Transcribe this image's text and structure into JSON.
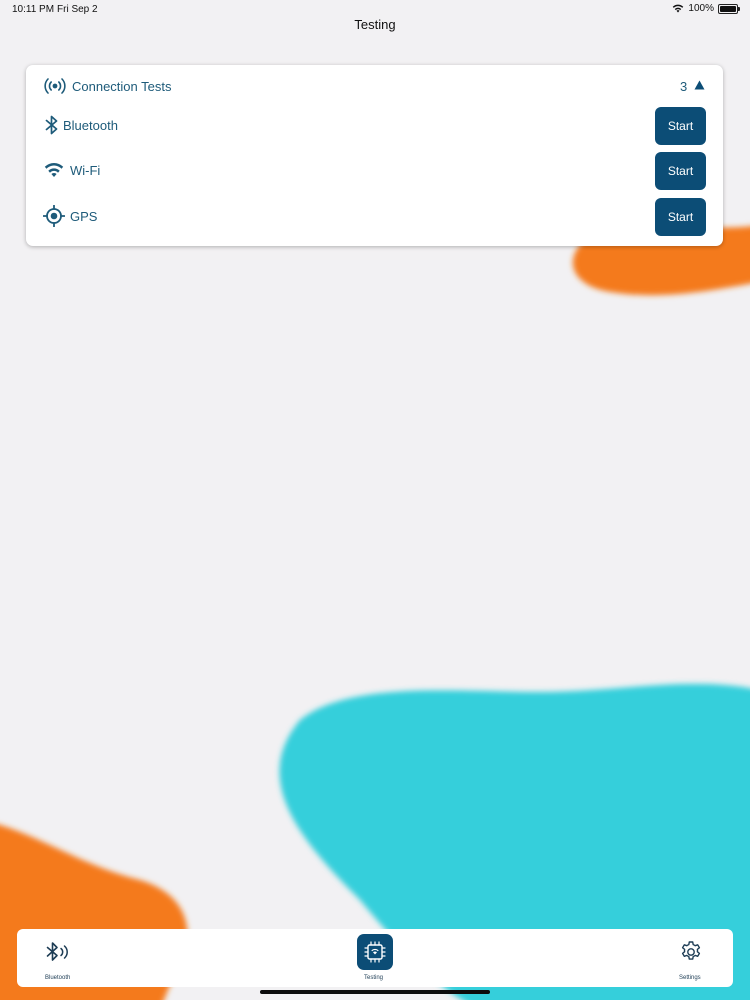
{
  "status_bar": {
    "time": "10:11 PM",
    "date": "Fri Sep 2",
    "battery": "100%"
  },
  "nav": {
    "title": "Testing"
  },
  "card": {
    "title": "Connection Tests",
    "count": "3",
    "header_icon": "broadcast-icon",
    "chevron_icon": "chevron-up-icon",
    "rows": [
      {
        "label": "Bluetooth",
        "icon": "bluetooth-icon",
        "button": "Start"
      },
      {
        "label": "Wi-Fi",
        "icon": "wifi-icon",
        "button": "Start"
      },
      {
        "label": "GPS",
        "icon": "gps-target-icon",
        "button": "Start"
      }
    ]
  },
  "tab_bar": {
    "tabs": [
      {
        "label": "Bluetooth",
        "icon": "bluetooth-signal-icon",
        "selected": false
      },
      {
        "label": "Testing",
        "icon": "chip-icon",
        "selected": true
      },
      {
        "label": "Settings",
        "icon": "gear-icon",
        "selected": false
      }
    ]
  },
  "colors": {
    "accent": "#0c4d76",
    "text_accent": "#1e5b7a",
    "background": "#f2f1f3",
    "orange_blob": "#f47a1d",
    "cyan_blob": "#35cfdb"
  }
}
